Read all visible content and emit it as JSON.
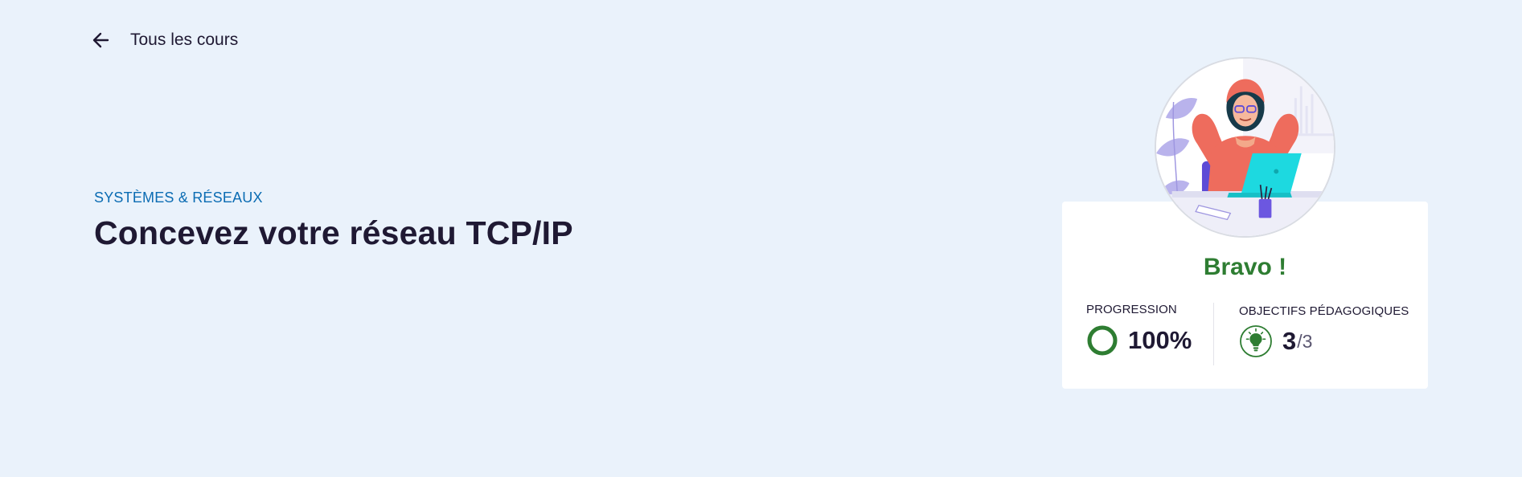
{
  "nav": {
    "back_label": "Tous les cours",
    "back_icon": "arrow-left-icon"
  },
  "course": {
    "category": "SYSTÈMES & RÉSEAUX",
    "title": "Concevez votre réseau TCP/IP"
  },
  "status_card": {
    "illustration": "relaxed-person-illustration",
    "message": "Bravo !",
    "progression": {
      "label": "PROGRESSION",
      "value": "100%",
      "fraction": 1.0
    },
    "objectives": {
      "label": "OBJECTIFS PÉDAGOGIQUES",
      "done": "3",
      "total": "/3",
      "icon": "lightbulb-icon"
    }
  },
  "colors": {
    "background": "#eaf2fb",
    "accent_blue": "#0b6cb3",
    "success_green": "#2e7d32",
    "text_dark": "#1f1933"
  }
}
